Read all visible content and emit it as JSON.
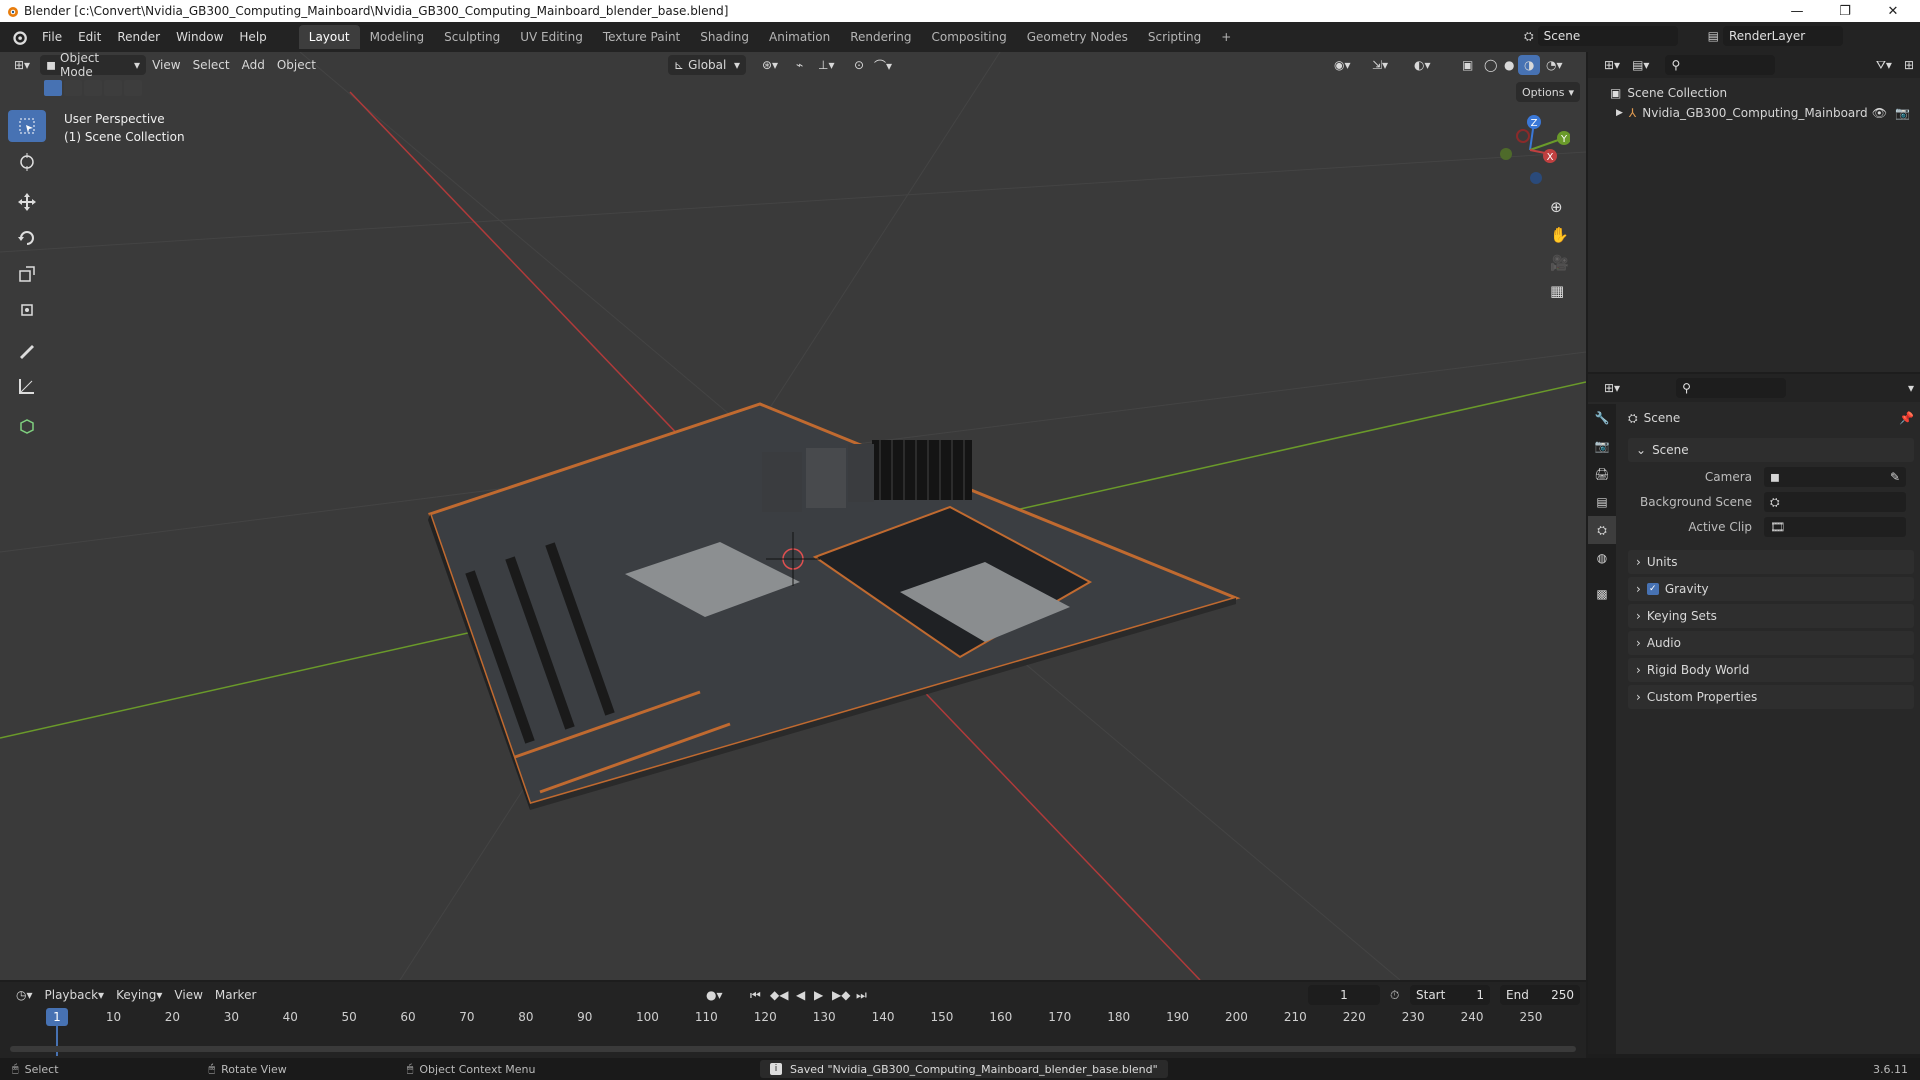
{
  "title_bar": {
    "title": "Blender [c:\\Convert\\Nvidia_GB300_Computing_Mainboard\\Nvidia_GB300_Computing_Mainboard_blender_base.blend]",
    "minimize": "—",
    "maximize": "❐",
    "close": "✕"
  },
  "menu": [
    "File",
    "Edit",
    "Render",
    "Window",
    "Help"
  ],
  "workspaces": [
    "Layout",
    "Modeling",
    "Sculpting",
    "UV Editing",
    "Texture Paint",
    "Shading",
    "Animation",
    "Rendering",
    "Compositing",
    "Geometry Nodes",
    "Scripting"
  ],
  "workspace_add": "+",
  "scene_name": "Scene",
  "render_layer": "RenderLayer",
  "viewport": {
    "mode": "Object Mode",
    "menus": [
      "View",
      "Select",
      "Add",
      "Object"
    ],
    "orientation": "Global",
    "options_label": "Options",
    "overlay_line1": "User Perspective",
    "overlay_line2": "(1) Scene Collection",
    "gizmo": {
      "z": "Z",
      "y": "Y",
      "x": "X"
    }
  },
  "outliner": {
    "root": "Scene Collection",
    "item": "Nvidia_GB300_Computing_Mainboard"
  },
  "properties": {
    "header": "Scene",
    "panel_scene": "Scene",
    "camera_label": "Camera",
    "background_scene_label": "Background Scene",
    "active_clip_label": "Active Clip",
    "panels": [
      "Units",
      "Gravity",
      "Keying Sets",
      "Audio",
      "Rigid Body World",
      "Custom Properties"
    ],
    "gravity_checked": true
  },
  "timeline": {
    "menus": [
      "Playback",
      "Keying",
      "View",
      "Marker"
    ],
    "current_frame": "1",
    "start_label": "Start",
    "start": "1",
    "end_label": "End",
    "end": "250",
    "ticks": [
      "10",
      "20",
      "30",
      "40",
      "50",
      "60",
      "70",
      "80",
      "90",
      "100",
      "110",
      "120",
      "130",
      "140",
      "150",
      "160",
      "170",
      "180",
      "190",
      "200",
      "210",
      "220",
      "230",
      "240",
      "250"
    ],
    "playhead": "1"
  },
  "status": {
    "select": "Select",
    "rotate": "Rotate View",
    "context": "Object Context Menu",
    "message": "Saved \"Nvidia_GB300_Computing_Mainboard_blender_base.blend\"",
    "version": "3.6.11"
  },
  "colors": {
    "accent": "#4772b3",
    "x_axis": "#c04040",
    "y_axis": "#6a9a2a",
    "z_axis": "#3a78d8",
    "board_trim": "#c06a30"
  }
}
